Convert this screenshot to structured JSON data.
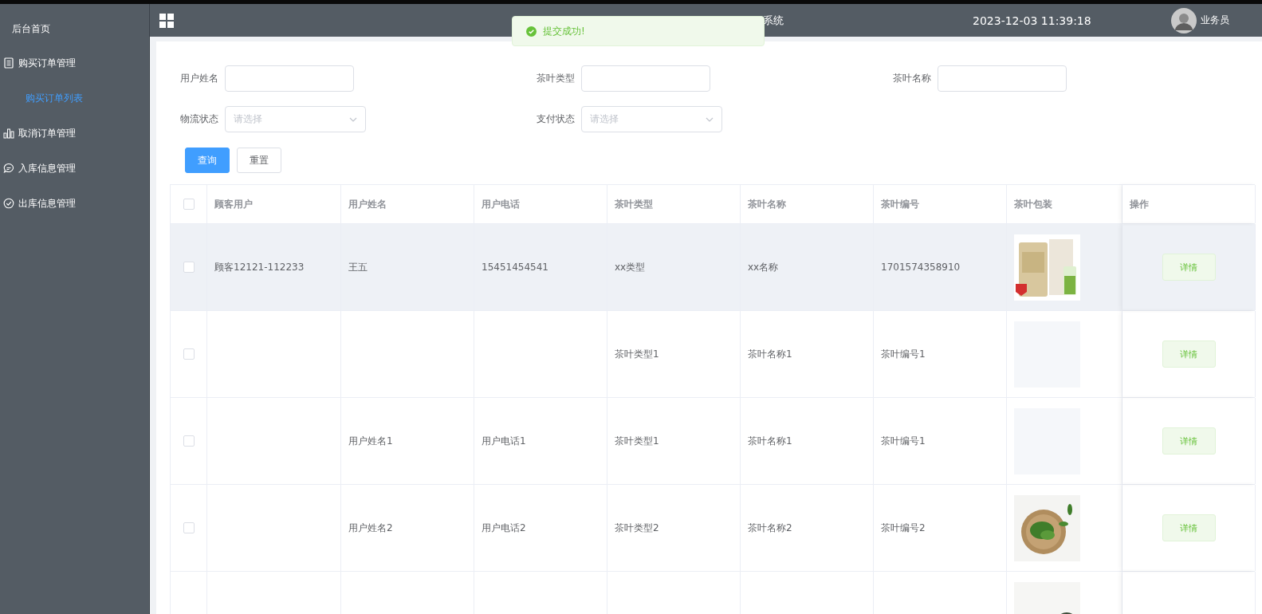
{
  "sidebar": {
    "home": "后台首页",
    "items": [
      {
        "label": "购买订单管理",
        "kind": "document",
        "children": [
          {
            "label": "购买订单列表",
            "selected": true
          }
        ]
      },
      {
        "label": "取消订单管理",
        "kind": "chart"
      },
      {
        "label": "入库信息管理",
        "kind": "chat"
      },
      {
        "label": "出库信息管理",
        "kind": "check"
      }
    ]
  },
  "header": {
    "title": "系统",
    "datetime": "2023-12-03 11:39:18",
    "user": "业务员"
  },
  "toast": {
    "kind": "success",
    "message": "提交成功!"
  },
  "filters": [
    {
      "label": "用户姓名",
      "kind": "input"
    },
    {
      "label": "茶叶类型",
      "kind": "input"
    },
    {
      "label": "茶叶名称",
      "kind": "input"
    },
    {
      "label": "物流状态",
      "kind": "select",
      "placeholder": "请选择"
    },
    {
      "label": "支付状态",
      "kind": "select",
      "placeholder": "请选择"
    }
  ],
  "buttons": [
    {
      "label": "查询",
      "kind": "primary"
    },
    {
      "label": "重置",
      "kind": "default"
    }
  ],
  "table": {
    "header_checked": false,
    "columns": [
      "顾客用户",
      "用户姓名",
      "用户电话",
      "茶叶类型",
      "茶叶名称",
      "茶叶编号",
      "茶叶包装",
      "操作"
    ],
    "rows": [
      {
        "checked": false,
        "hovered": true,
        "cells": [
          "顾客12121-112233",
          "王五",
          "15451454541",
          "xx类型",
          "xx名称",
          "1701574358910"
        ],
        "action": "详情"
      },
      {
        "checked": false,
        "hovered": false,
        "cells": [
          null,
          null,
          null,
          "茶叶类型1",
          "茶叶名称1",
          "茶叶编号1"
        ],
        "image": {
          "kind": "empty"
        },
        "action": "详情"
      },
      {
        "checked": false,
        "hovered": false,
        "cells": [
          null,
          "用户姓名1",
          "用户电话1",
          "茶叶类型1",
          "茶叶名称1",
          "茶叶编号1"
        ],
        "image": {
          "kind": "empty"
        },
        "action": "详情"
      },
      {
        "checked": false,
        "hovered": false,
        "cells": [
          null,
          "用户姓名2",
          "用户电话2",
          "茶叶类型2",
          "茶叶名称2",
          "茶叶编号2"
        ],
        "action": "详情"
      },
      {
        "hovered": false,
        "cells": [
          null,
          null,
          null,
          null,
          null,
          null
        ]
      }
    ]
  }
}
